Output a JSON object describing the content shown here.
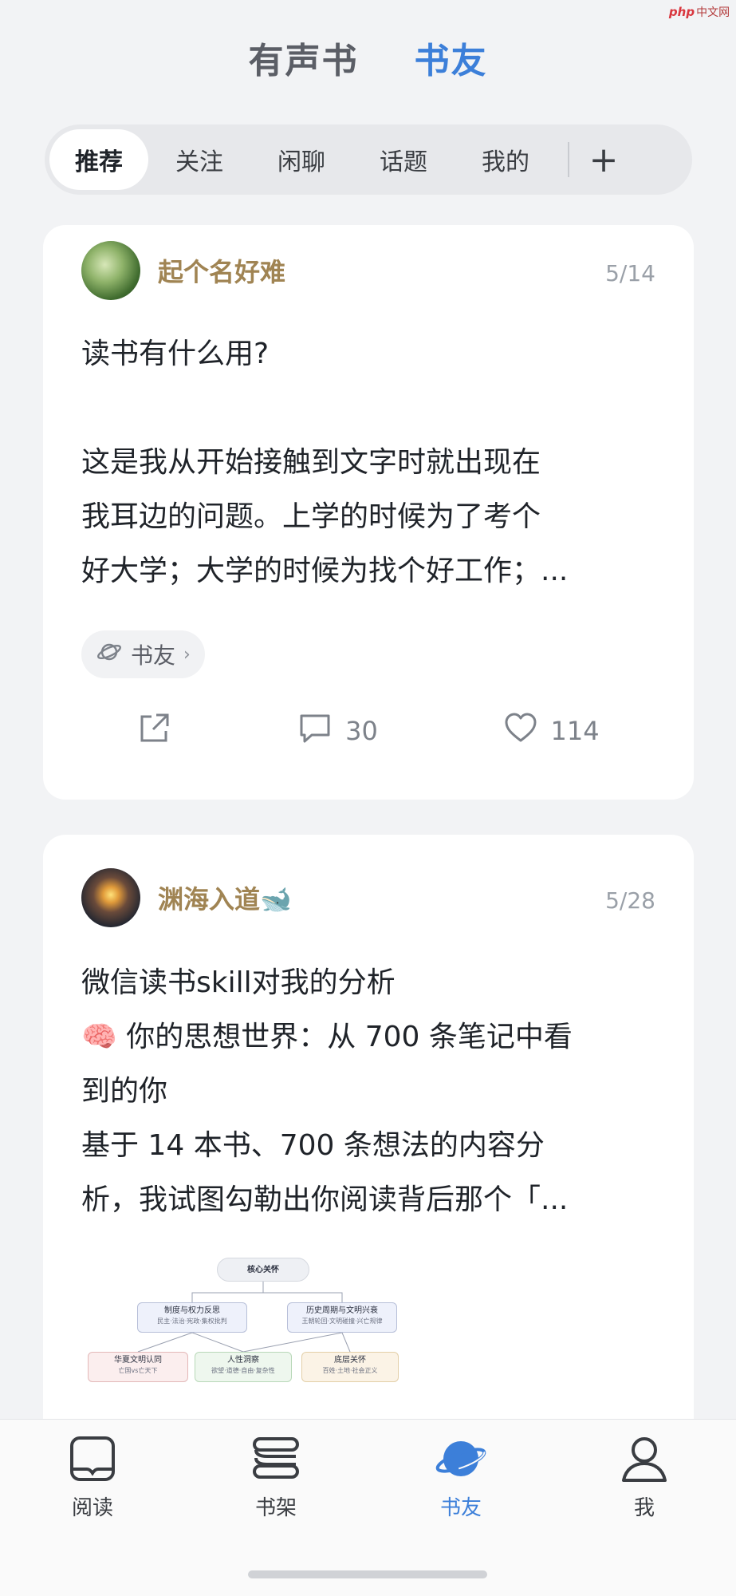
{
  "watermark": {
    "brand": "php",
    "text": "中文网"
  },
  "top_tabs": [
    {
      "label": "有声书",
      "active": false
    },
    {
      "label": "书友",
      "active": true
    }
  ],
  "sub_tabs": [
    {
      "label": "推荐",
      "active": true
    },
    {
      "label": "关注",
      "active": false
    },
    {
      "label": "闲聊",
      "active": false
    },
    {
      "label": "话题",
      "active": false
    },
    {
      "label": "我的",
      "active": false
    }
  ],
  "sub_tabs_plus": "+",
  "posts": [
    {
      "author": "起个名好难",
      "date": "5/14",
      "lines": [
        "读书有什么用?",
        "",
        "这是我从开始接触到文字时就出现在",
        "我耳边的问题。上学的时候为了考个",
        "好大学；大学的时候为找个好工作；..."
      ],
      "tag": "书友",
      "actions": {
        "comments": "30",
        "likes": "114"
      }
    },
    {
      "author": "渊海入道",
      "author_emoji": "🐋",
      "date": "5/28",
      "lines": [
        "微信读书skill对我的分析",
        "🧠 你的思想世界：从 700 条笔记中看",
        "到的你",
        "基于 14 本书、700 条想法的内容分",
        "析，我试图勾勒出你阅读背后那个「..."
      ],
      "mindmap": {
        "root": "核心关怀",
        "nodes": [
          {
            "title": "制度与权力反思",
            "sub": "民主·法治·宪政·集权批判"
          },
          {
            "title": "历史周期与文明兴衰",
            "sub": "王朝轮回·文明碰撞·兴亡规律"
          },
          {
            "title": "华夏文明认同",
            "sub": "亡国vs亡天下"
          },
          {
            "title": "人性洞察",
            "sub": "欲望·道德·自由·复杂性"
          },
          {
            "title": "底层关怀",
            "sub": "百姓·土地·社会正义"
          }
        ]
      }
    }
  ],
  "bottom_nav": [
    {
      "label": "阅读",
      "icon": "book-reading-icon",
      "active": false
    },
    {
      "label": "书架",
      "icon": "bookshelf-icon",
      "active": false
    },
    {
      "label": "书友",
      "icon": "planet-icon",
      "active": true
    },
    {
      "label": "我",
      "icon": "profile-icon",
      "active": false
    }
  ],
  "colors": {
    "accent": "#3c7fd9",
    "author": "#a08453",
    "background": "#f2f3f5"
  }
}
